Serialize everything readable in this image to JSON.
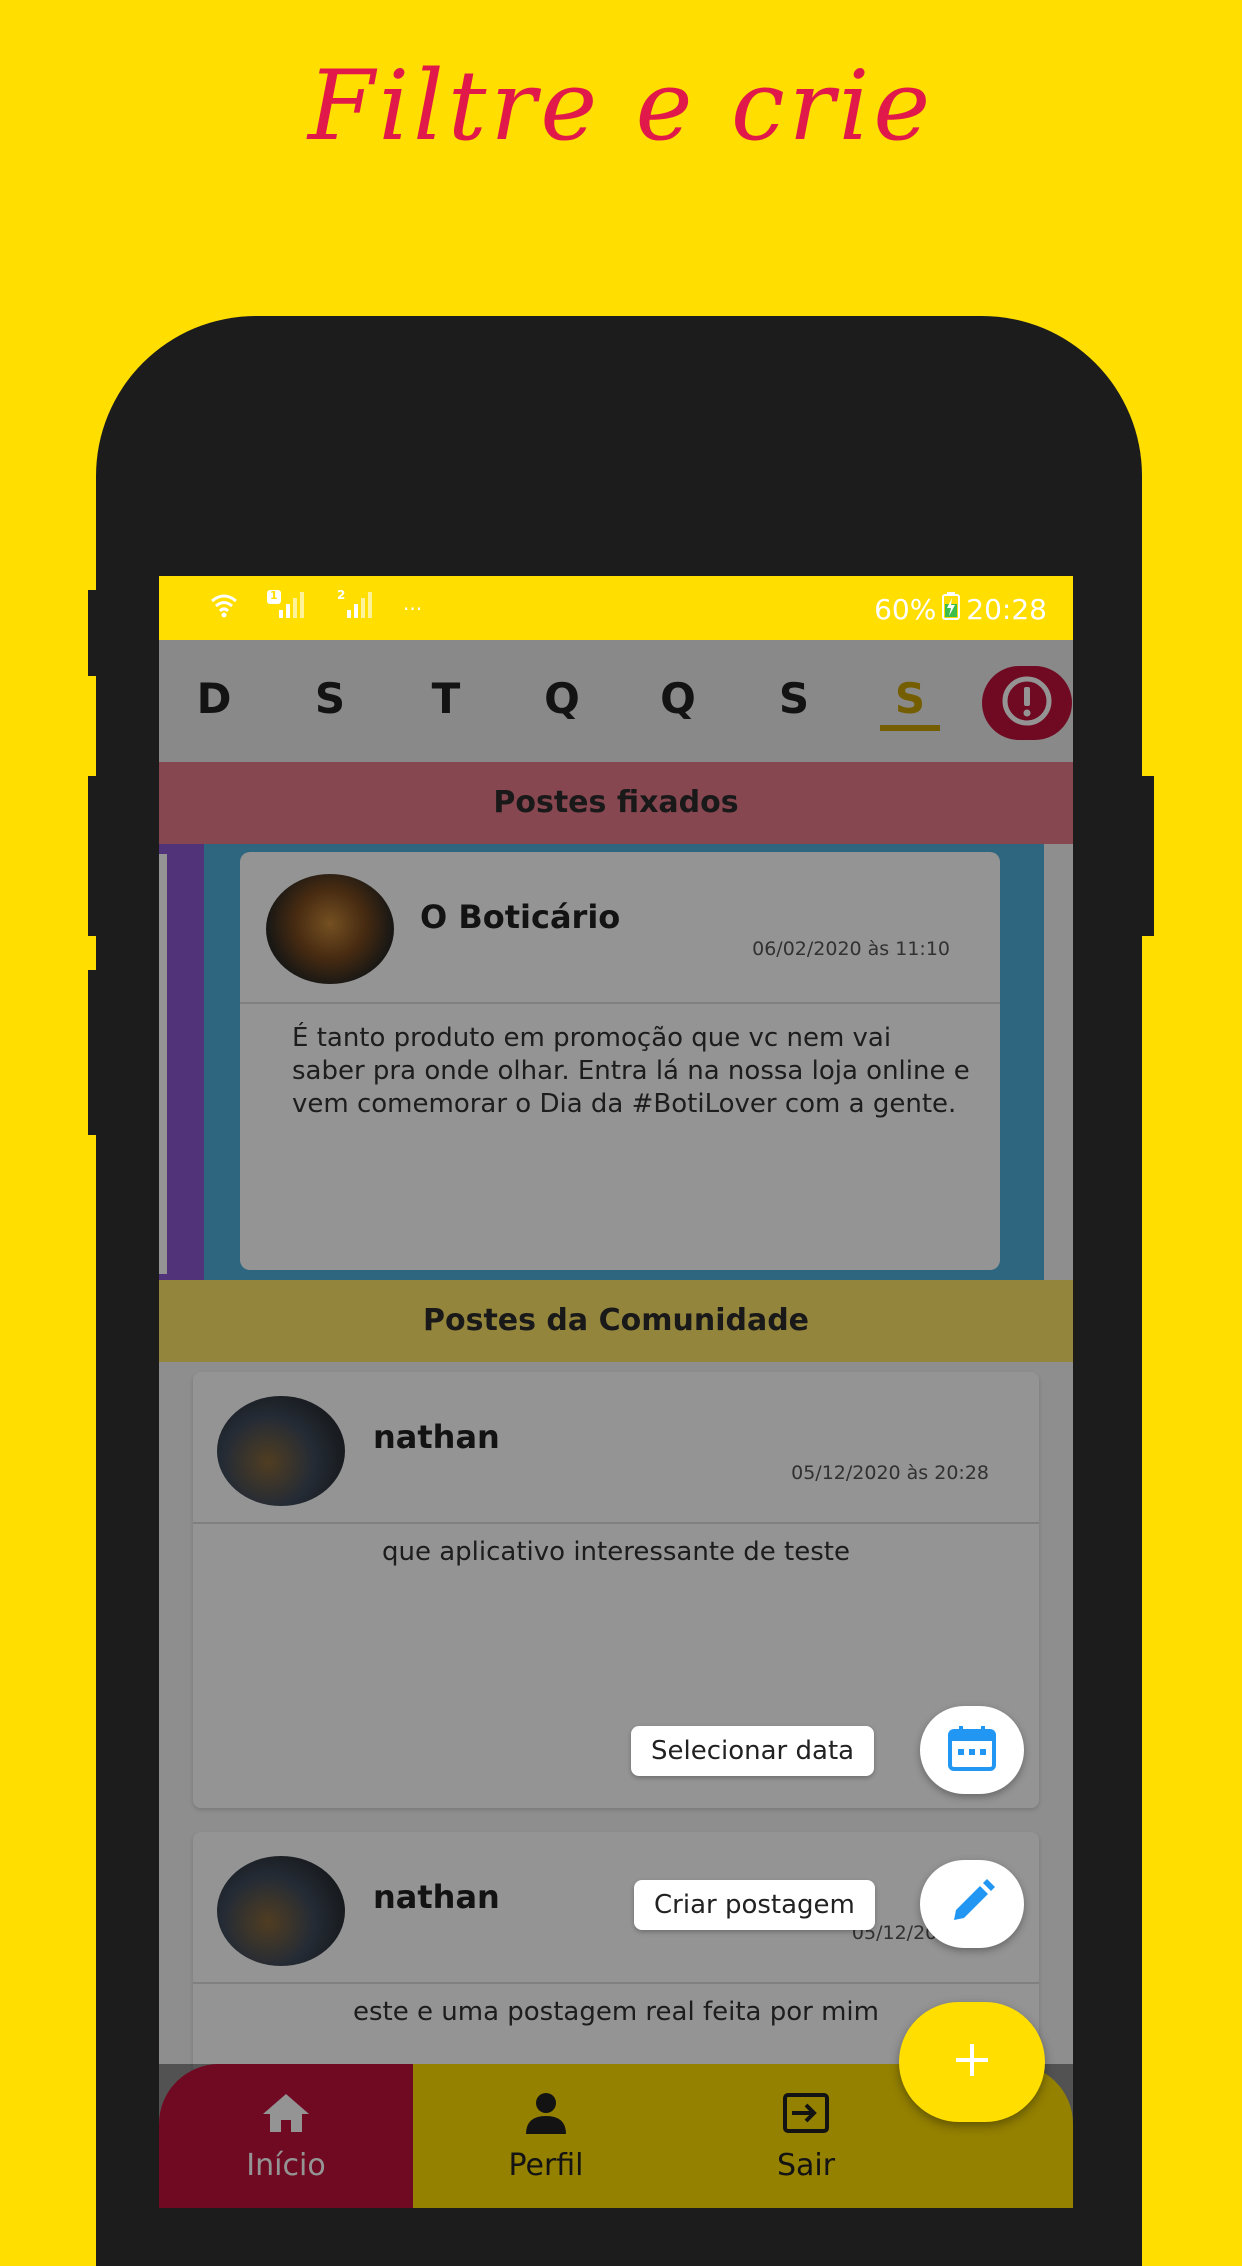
{
  "headline": "Filtre e crie",
  "status_bar": {
    "battery": "60%",
    "time": "20:28",
    "sim1_badge": "1",
    "sim2_badge": "2",
    "more": "···"
  },
  "days": [
    "D",
    "S",
    "T",
    "Q",
    "Q",
    "S",
    "S"
  ],
  "active_day_index": 6,
  "sections": {
    "pinned": "Postes fixados",
    "community": "Postes da Comunidade"
  },
  "pinned_post": {
    "author": "O Boticário",
    "date": "06/02/2020 às 11:10",
    "body": "É tanto produto em promoção que vc nem vai saber pra onde olhar.  Entra lá na nossa loja online e vem comemorar o Dia da #BotiLover com a gente."
  },
  "community_posts": [
    {
      "author": "nathan",
      "date": "05/12/2020 às 20:28",
      "body": "que aplicativo interessante de teste"
    },
    {
      "author": "nathan",
      "date": "05/12/2020 às",
      "body": "este e uma postagem real feita por mim"
    }
  ],
  "fab": {
    "select_date_label": "Selecionar data",
    "create_post_label": "Criar postagem",
    "main_icon": "plus-icon"
  },
  "nav": {
    "home": "Início",
    "profile": "Perfil",
    "logout": "Sair"
  },
  "colors": {
    "brand_yellow": "#FFDE00",
    "accent_red": "#C1123C",
    "headline_red": "#E0194A",
    "fab_icon_blue": "#2196F3"
  }
}
